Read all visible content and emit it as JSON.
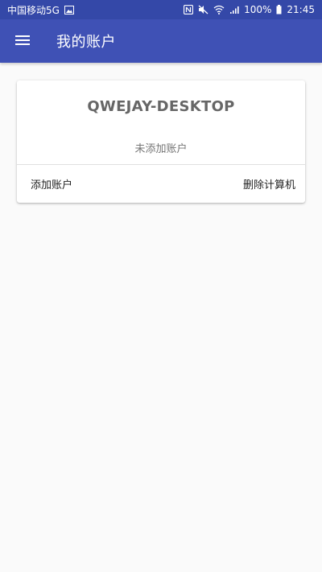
{
  "status_bar": {
    "carrier": "中国移动5G",
    "battery": "100%",
    "time": "21:45"
  },
  "app_bar": {
    "title": "我的账户",
    "background": "#3f51b5"
  },
  "card": {
    "computer_name": "QWEJAY-DESKTOP",
    "account_status": "未添加账户",
    "add_account_label": "添加账户",
    "delete_computer_label": "删除计算机"
  },
  "icons": {
    "status_left": [
      "image-icon"
    ],
    "status_right": [
      "nfc-icon",
      "mute-icon",
      "wifi-icon",
      "signal-icon",
      "battery-icon"
    ],
    "app_bar": [
      "menu-icon"
    ]
  }
}
